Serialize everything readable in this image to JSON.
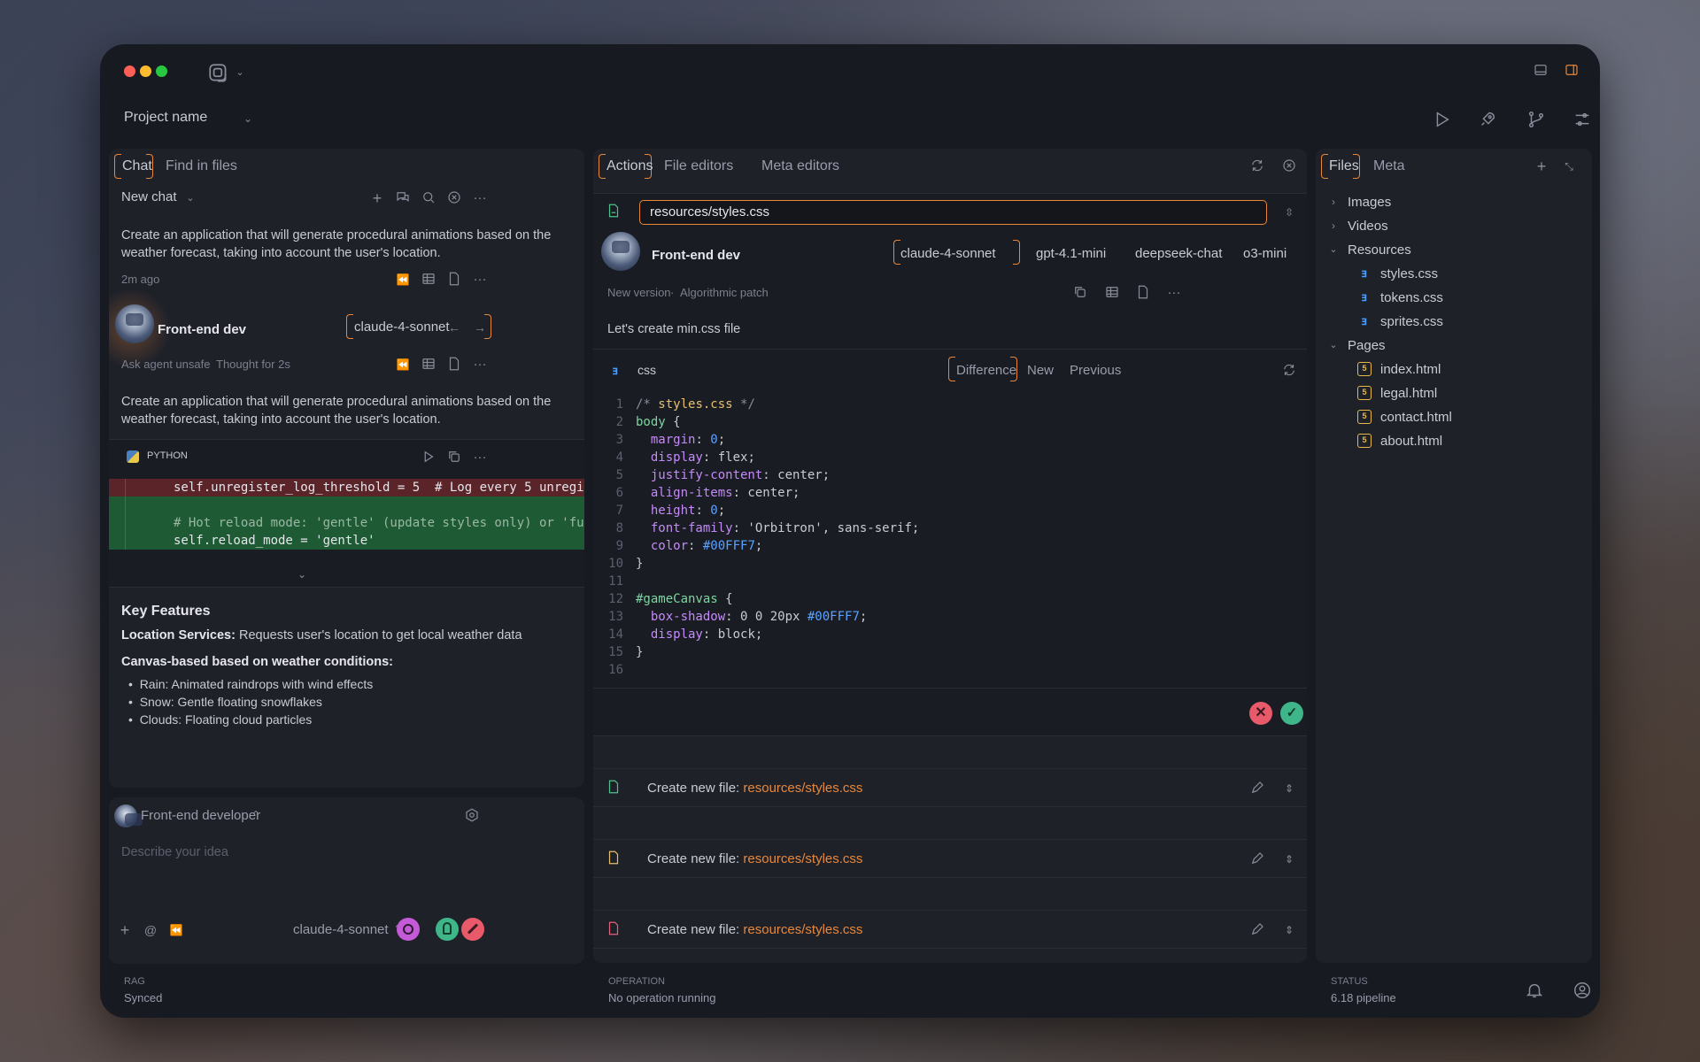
{
  "title_bar": {
    "project_name": "Project name"
  },
  "chat_panel": {
    "tabs": [
      "Chat",
      "Find in files"
    ],
    "new_chat": "New chat",
    "user_message": "Create an application that will generate procedural animations based on the weather forecast, taking into account the user's location.",
    "time": "2m ago",
    "agent_name": "Front-end dev",
    "agent_model": "claude-4-sonnet",
    "agent_meta1": "Ask agent unsafe",
    "agent_meta2": "Thought for 2s",
    "agent_message": "Create an application that will generate procedural animations based on the weather forecast, taking into account the user's location.",
    "code_lang": "PYTHON",
    "diff_removed": "self.unregister_log_threshold = 5  # Log every 5 unregi",
    "diff_added1": "# Hot reload mode: 'gentle' (update styles only) or 'fu",
    "diff_added2": "self.reload_mode = 'gentle'",
    "key_features_title": "Key Features",
    "loc_label": "Location Services:",
    "loc_text": " Requests user's location to get local weather data",
    "canvas_label": "Canvas-based based on weather conditions:",
    "bullets": [
      "Rain: Animated raindrops with wind effects",
      "Snow: Gentle floating snowflakes",
      "Clouds: Floating cloud particles"
    ]
  },
  "composer": {
    "agent": "Front-end developer",
    "placeholder": "Describe your idea",
    "model": "claude-4-sonnet"
  },
  "actions_panel": {
    "tabs": [
      "Actions",
      "File editors",
      "Meta editors"
    ],
    "file_path": "resources/styles.css",
    "agent_name": "Front-end dev",
    "models": [
      "claude-4-sonnet",
      "gpt-4.1-mini",
      "deepseek-chat",
      "o3-mini"
    ],
    "meta1": "New version",
    "meta2": "Algorithmic patch",
    "message": "Let's create min.css file",
    "code_lang": "css",
    "code_tabs": [
      "Difference",
      "New",
      "Previous"
    ],
    "actions": [
      {
        "prefix": "Create new file: ",
        "path": "resources/styles.css",
        "color": "#4cc38a"
      },
      {
        "prefix": "Create new file: ",
        "path": "resources/styles.css",
        "color": "#e8c06a"
      },
      {
        "prefix": "Create new file: ",
        "path": "resources/styles.css",
        "color": "#e8607a"
      }
    ]
  },
  "files_panel": {
    "tabs": [
      "Files",
      "Meta"
    ],
    "tree": [
      {
        "label": "Images",
        "type": "folder",
        "open": false
      },
      {
        "label": "Videos",
        "type": "folder",
        "open": false
      },
      {
        "label": "Resources",
        "type": "folder",
        "open": true
      },
      {
        "label": "styles.css",
        "type": "css"
      },
      {
        "label": "tokens.css",
        "type": "css"
      },
      {
        "label": "sprites.css",
        "type": "css"
      },
      {
        "label": "Pages",
        "type": "folder",
        "open": true
      },
      {
        "label": "index.html",
        "type": "html"
      },
      {
        "label": "legal.html",
        "type": "html"
      },
      {
        "label": "contact.html",
        "type": "html"
      },
      {
        "label": "about.html",
        "type": "html"
      }
    ]
  },
  "status_bar": {
    "rag_label": "RAG",
    "rag_value": "Synced",
    "op_label": "OPERATION",
    "op_value": "No operation running",
    "status_label": "STATUS",
    "status_value": "6.18 pipeline"
  },
  "colors": {
    "accent": "#e8873a",
    "removed": "#5a2428",
    "added": "#1e5a34"
  }
}
